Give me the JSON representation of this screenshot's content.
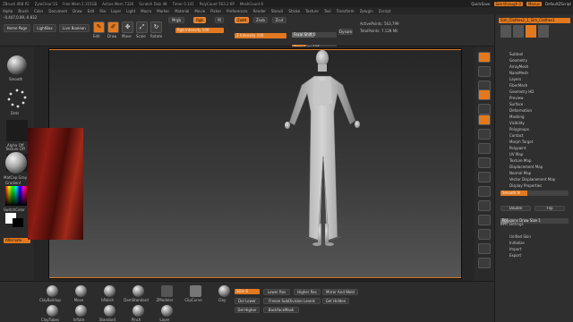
{
  "titlebar": {
    "left": "ZBrush 4R8 P2",
    "items": [
      "ZyloClear:1S",
      "Free Mem 2.115GB",
      "Active Mem 7326",
      "Scratch Disk 48",
      "Timer 0.141",
      "PolyCount 563.2 KP",
      "MeshCount 6"
    ],
    "quicksave": "QuickSave",
    "see_through": "See-through 0",
    "menus": "Menus",
    "default_script": "DefaultZScript"
  },
  "menubar": {
    "items": [
      "Alpha",
      "Brush",
      "Color",
      "Document",
      "Draw",
      "Edit",
      "File",
      "Layer",
      "Light",
      "Macro",
      "Marker",
      "Material",
      "Movie",
      "Picker",
      "Preferences",
      "Render",
      "Stencil",
      "Stroke",
      "Texture",
      "Tool",
      "Transform",
      "Zplugin",
      "Zscript"
    ]
  },
  "toolbar": {
    "coords": "-0.447,0.89,-0.832",
    "home_page": "Home Page",
    "lightbox": "LightBox",
    "live_boolean": "Live Boolean",
    "edit": "Edit",
    "draw": "Draw",
    "move": "Move",
    "scale": "Scale",
    "rotate": "Rotate",
    "mrgb": "Mrgb",
    "rgb": "Rgb",
    "m": "M",
    "zadd": "Zadd",
    "zsub": "Zsub",
    "zcut": "Zcut",
    "rgb_intensity": "Rgb Intensity 100",
    "z_intensity": "Z Intensity 100",
    "focal_shift": "Focal Shift 0",
    "draw_size": "Draw Size 116",
    "dynamic": "Dynamic",
    "active_points": "ActivePoints: 563,799",
    "total_points": "TotalPoints: 7.128 Mil"
  },
  "leftshelf": {
    "smooth": "Smooth",
    "dots": "Dots",
    "alpha_off": "Alpha Off",
    "texture_off": "Texture Off",
    "matcap": "MatCap Gray",
    "gradient": "Gradient",
    "switch_color": "SwitchColor",
    "alternate": "Alternate"
  },
  "rightshelf": {
    "buttons": [
      "BPR",
      "SPix 3",
      "Scroll",
      "Zoom",
      "Actual",
      "AAHalf",
      "Persp",
      "Floor",
      "Local",
      "Gizmo",
      "Frame",
      "Move",
      "Scale",
      "Rotate",
      "Line Fill",
      "PolyF",
      "Transp",
      "Dynamic",
      "Solo",
      "Xpose"
    ]
  },
  "tray": {
    "top": [
      "Sim_Clothes2_1_Sim_Clothes1",
      "Sim_Clothes1",
      "Sim_Clothes2",
      "Sim_Clothes3"
    ],
    "items": [
      "Subtool",
      "Geometry",
      "ArrayMesh",
      "NanoMesh",
      "Layers",
      "FiberMesh",
      "Geometry HD",
      "Preview",
      "Surface",
      "Deformation",
      "Masking",
      "Visibility",
      "Polygroups",
      "Contact",
      "Morph Target",
      "Polypaint",
      "UV Map",
      "Texture Map",
      "Displacement Map",
      "Normal Map",
      "Vector Displacement Map",
      "Display Properties"
    ],
    "unified_skin": "Unified Skin",
    "initialize": "Initialize",
    "import": "Import",
    "export": "Export",
    "smooth_normals": "Smooth N",
    "double": "Double",
    "flip": "Flip",
    "polygon_draw": "Polygons Draw Size 1",
    "bpr_settings": "BPR Settings"
  },
  "bottom": {
    "brushes": [
      "ClayBuildup",
      "Move",
      "hPolish",
      "DamStandard",
      "ZModeler",
      "ClipCurve",
      "Clay",
      "ClayTubes",
      "Inflate",
      "Standard",
      "Pinch",
      "Layer"
    ],
    "sdiv": "SDiv 6",
    "lower_res": "Lower Res",
    "higher_res": "Higher Res",
    "mirror_weld": "Mirror And Weld",
    "del_lower": "Del Lower",
    "del_higher": "Del Higher",
    "freeze_subdiv": "Freeze SubDivision Levels",
    "backface_mask": "BackfaceMask",
    "get_hidden": "Get Hidden",
    "colors": {
      "accent": "#e2791e",
      "dark": "#2b2b2b"
    }
  },
  "colors": {
    "accent": "#e2791e",
    "canvas_top": "#262626",
    "canvas_bottom": "#555555"
  }
}
